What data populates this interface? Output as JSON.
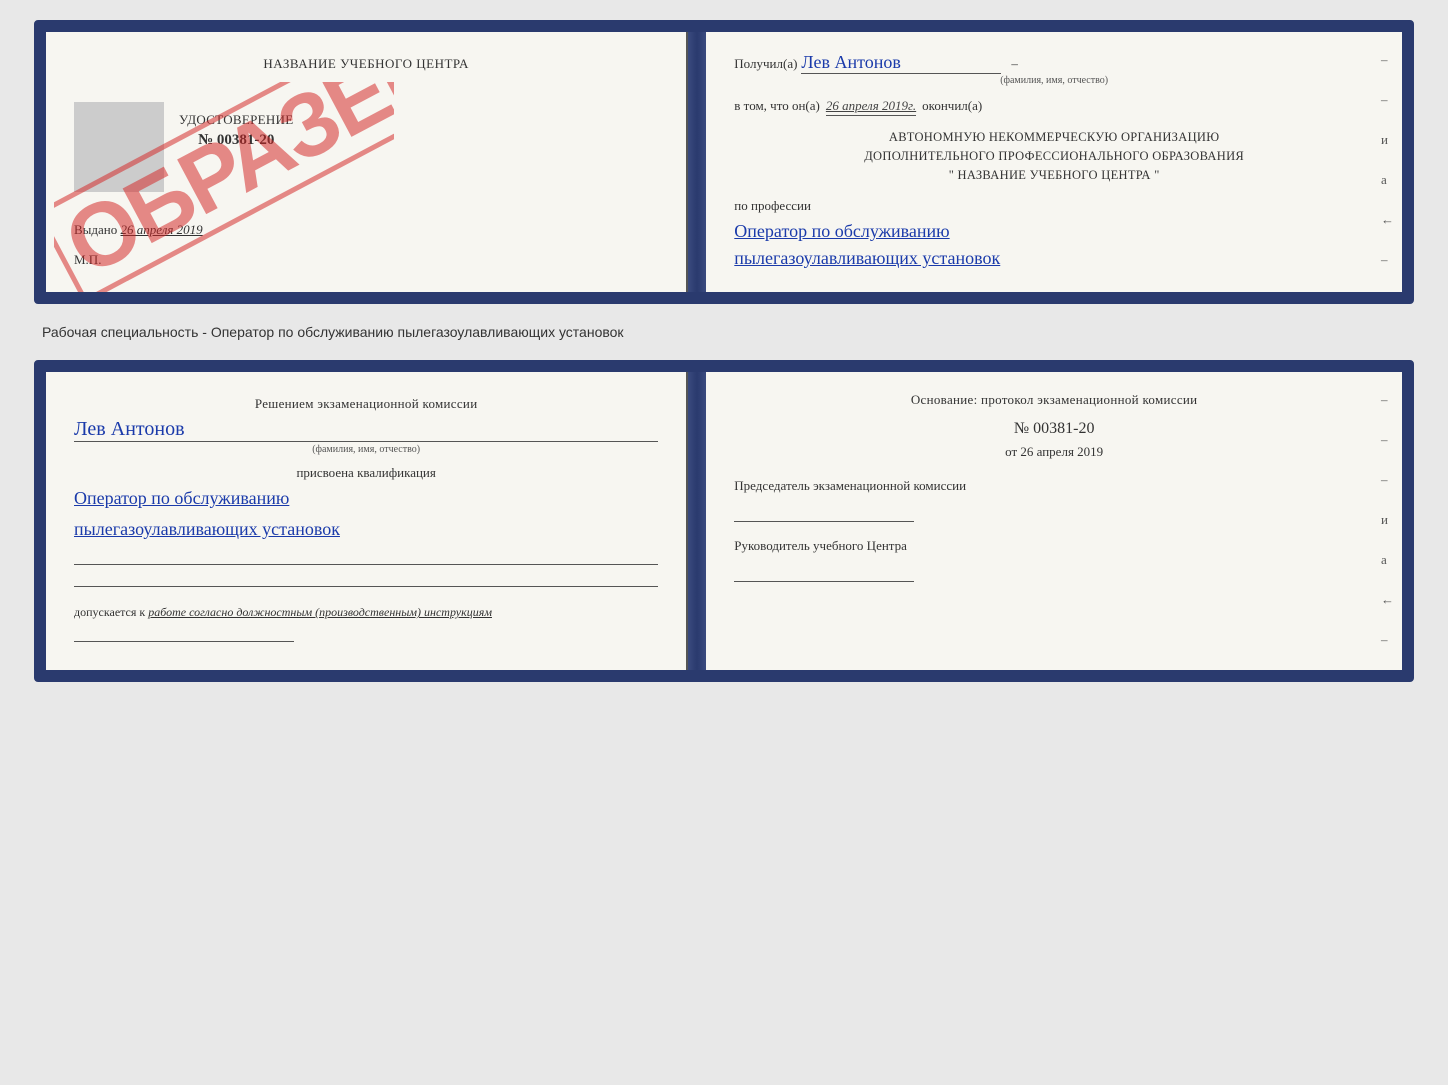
{
  "top_doc": {
    "left": {
      "center_title": "НАЗВАНИЕ УЧЕБНОГО ЦЕНТРА",
      "stamp_placeholder": "",
      "udostoverenie_title": "УДОСТОВЕРЕНИЕ",
      "udostoverenie_number": "№ 00381-20",
      "obrazets": "ОБРАЗЕЦ",
      "vydano_label": "Выдано",
      "vydano_date": "26 апреля 2019",
      "mp": "М.П."
    },
    "right": {
      "poluchil_label": "Получил(а)",
      "poluchil_value": "Лев Антонов",
      "fio_subtitle": "(фамилия, имя, отчество)",
      "vtom_label": "в том, что он(а)",
      "vtom_date": "26 апреля 2019г.",
      "okonchil_label": "окончил(а)",
      "org_line1": "АВТОНОМНУЮ НЕКОММЕРЧЕСКУЮ ОРГАНИЗАЦИЮ",
      "org_line2": "ДОПОЛНИТЕЛЬНОГО ПРОФЕССИОНАЛЬНОГО ОБРАЗОВАНИЯ",
      "org_name_prefix": "\"",
      "org_name": "НАЗВАНИЕ УЧЕБНОГО ЦЕНТРА",
      "org_name_suffix": "\"",
      "po_professii_label": "по профессии",
      "profession_line1": "Оператор по обслуживанию",
      "profession_line2": "пылегазоулавливающих установок",
      "dashes": [
        "-",
        "-",
        "и",
        "а",
        "←",
        "-",
        "-",
        "-",
        "-"
      ]
    }
  },
  "middle_text": "Рабочая специальность - Оператор по обслуживанию пылегазоулавливающих установок",
  "bottom_doc": {
    "left": {
      "komissia_title": "Решением экзаменационной комиссии",
      "name_value": "Лев Антонов",
      "fio_subtitle": "(фамилия, имя, отчество)",
      "prisvoena_label": "присвоена квалификация",
      "qualification_line1": "Оператор по обслуживанию",
      "qualification_line2": "пылегазоулавливающих установок",
      "blank1": "",
      "blank2": "",
      "dopuskaetsya_label": "допускается к",
      "dopuskaetsya_value": "работе согласно должностным (производственным) инструкциям",
      "blank3": ""
    },
    "right": {
      "osnov_label": "Основание: протокол экзаменационной комиссии",
      "protokol_number": "№ 00381-20",
      "ot_prefix": "от",
      "ot_date": "26 апреля 2019",
      "predsedatel_label": "Председатель экзаменационной комиссии",
      "rukovoditel_label": "Руководитель учебного Центра",
      "dashes": [
        "-",
        "-",
        "-",
        "и",
        "а",
        "←",
        "-",
        "-",
        "-",
        "-"
      ]
    }
  }
}
